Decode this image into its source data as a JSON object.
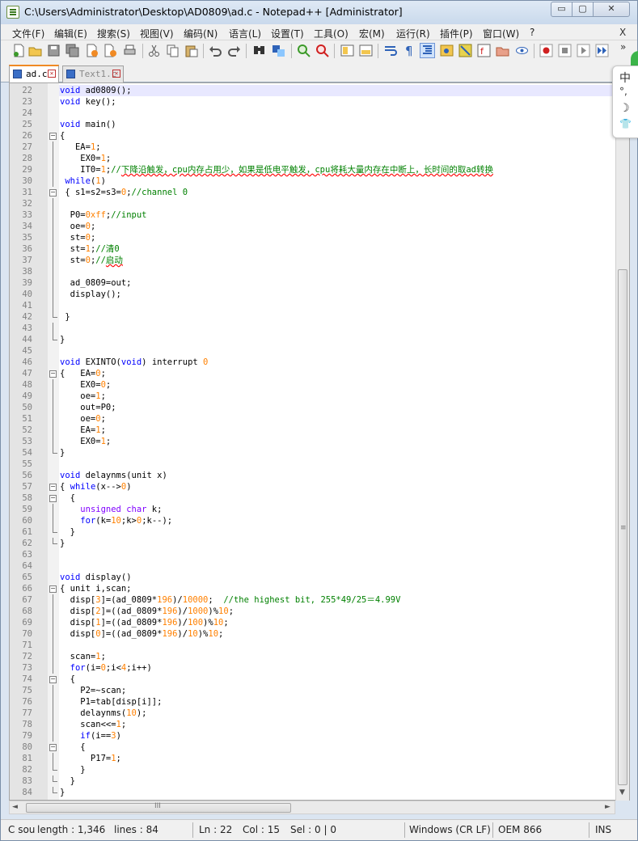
{
  "window": {
    "title": "C:\\Users\\Administrator\\Desktop\\AD0809\\ad.c - Notepad++ [Administrator]",
    "min_label": "▭",
    "max_label": "▢",
    "close_label": "✕"
  },
  "menu": {
    "items": [
      "文件(F)",
      "编辑(E)",
      "搜索(S)",
      "视图(V)",
      "编码(N)",
      "语言(L)",
      "设置(T)",
      "工具(O)",
      "宏(M)",
      "运行(R)",
      "插件(P)",
      "窗口(W)",
      "?"
    ],
    "close": "X"
  },
  "toolbar": {
    "overflow": "»",
    "icons": [
      "new-file-icon",
      "open-file-icon",
      "save-icon",
      "save-all-icon",
      "close-icon",
      "close-all-icon",
      "print-icon",
      "cut-icon",
      "copy-icon",
      "paste-icon",
      "undo-icon",
      "redo-icon",
      "find-icon",
      "replace-icon",
      "zoom-in-icon",
      "zoom-out-icon",
      "sync-vertical-icon",
      "sync-horizontal-icon",
      "word-wrap-icon",
      "show-all-chars-icon",
      "indent-guide-icon",
      "user-lang-icon",
      "doc-map-icon",
      "function-list-icon",
      "folder-workspace-icon",
      "monitoring-icon",
      "record-macro-icon",
      "stop-macro-icon",
      "play-macro-icon",
      "run-macro-multiple-icon"
    ],
    "colors": {
      "green": "#3c9a2a",
      "blue": "#2e62b8",
      "red": "#d02020",
      "orange": "#f08a24"
    }
  },
  "tabs": [
    {
      "label": "ad.c",
      "active": true
    },
    {
      "label": "Text1.c",
      "active": false
    }
  ],
  "ime": {
    "glyphs": [
      "中",
      "°,",
      "☽",
      "👕"
    ]
  },
  "editor": {
    "lines": [
      {
        "n": "22",
        "fold": "",
        "html": "<span class=\"kw\">void</span> ad0809();"
      },
      {
        "n": "23",
        "fold": "",
        "html": "<span class=\"kw\">void</span> key();"
      },
      {
        "n": "24",
        "fold": "",
        "html": ""
      },
      {
        "n": "25",
        "fold": "",
        "html": "<span class=\"kw\">void</span> main()"
      },
      {
        "n": "26",
        "fold": "box",
        "html": "{"
      },
      {
        "n": "27",
        "fold": "line",
        "html": "   EA=<span class=\"num\">1</span>;"
      },
      {
        "n": "28",
        "fold": "line",
        "html": "    EX0=<span class=\"num\">1</span>;"
      },
      {
        "n": "29",
        "fold": "line",
        "html": "    IT0=<span class=\"num\">1</span>;<span class=\"cmt\">//</span><span class=\"cmt-cn\">下降沿触发，cpu内存占用少，如果是低电平触发，cpu将耗大量内存在中断上，长时间的取ad转换</span>"
      },
      {
        "n": "30",
        "fold": "line",
        "html": " <span class=\"kw\">while</span>(<span class=\"num\">1</span>)"
      },
      {
        "n": "31",
        "fold": "box",
        "html": " { s1=s2=s3=<span class=\"num\">0</span>;<span class=\"cmt\">//channel 0</span>"
      },
      {
        "n": "32",
        "fold": "line",
        "html": "    "
      },
      {
        "n": "33",
        "fold": "line",
        "html": "  P0=<span class=\"num\">0xff</span>;<span class=\"cmt\">//input</span>"
      },
      {
        "n": "34",
        "fold": "line",
        "html": "  oe=<span class=\"num\">0</span>;"
      },
      {
        "n": "35",
        "fold": "line",
        "html": "  st=<span class=\"num\">0</span>;"
      },
      {
        "n": "36",
        "fold": "line",
        "html": "  st=<span class=\"num\">1</span>;<span class=\"cmt\">//清0</span>"
      },
      {
        "n": "37",
        "fold": "line",
        "html": "  st=<span class=\"num\">0</span>;<span class=\"cmt\">//</span><span class=\"cmt-cn\">启动</span>"
      },
      {
        "n": "38",
        "fold": "line",
        "html": ""
      },
      {
        "n": "39",
        "fold": "line",
        "html": "  ad_0809=out;"
      },
      {
        "n": "40",
        "fold": "line",
        "html": "  display();"
      },
      {
        "n": "41",
        "fold": "line",
        "html": ""
      },
      {
        "n": "42",
        "fold": "end",
        "html": " }"
      },
      {
        "n": "43",
        "fold": "line",
        "html": ""
      },
      {
        "n": "44",
        "fold": "end",
        "html": "}"
      },
      {
        "n": "45",
        "fold": "",
        "html": ""
      },
      {
        "n": "46",
        "fold": "",
        "html": "<span class=\"kw\">void</span> EXINTO(<span class=\"kw\">void</span>) interrupt <span class=\"num\">0</span>"
      },
      {
        "n": "47",
        "fold": "box",
        "html": "{   EA=<span class=\"num\">0</span>;"
      },
      {
        "n": "48",
        "fold": "line",
        "html": "    EX0=<span class=\"num\">0</span>;"
      },
      {
        "n": "49",
        "fold": "line",
        "html": "    oe=<span class=\"num\">1</span>;"
      },
      {
        "n": "50",
        "fold": "line",
        "html": "    out=P0;"
      },
      {
        "n": "51",
        "fold": "line",
        "html": "    oe=<span class=\"num\">0</span>;"
      },
      {
        "n": "52",
        "fold": "line",
        "html": "    EA=<span class=\"num\">1</span>;"
      },
      {
        "n": "53",
        "fold": "line",
        "html": "    EX0=<span class=\"num\">1</span>;"
      },
      {
        "n": "54",
        "fold": "end",
        "html": "}"
      },
      {
        "n": "55",
        "fold": "",
        "html": ""
      },
      {
        "n": "56",
        "fold": "",
        "html": "<span class=\"kw\">void</span> delaynms(unit x)"
      },
      {
        "n": "57",
        "fold": "box",
        "html": "{ <span class=\"kw\">while</span>(x--&gt;<span class=\"num\">0</span>)"
      },
      {
        "n": "58",
        "fold": "box",
        "html": "  {"
      },
      {
        "n": "59",
        "fold": "line",
        "html": "    <span class=\"typ\">unsigned char</span> k;"
      },
      {
        "n": "60",
        "fold": "line",
        "html": "    <span class=\"kw\">for</span>(k=<span class=\"num\">10</span>;k&gt;<span class=\"num\">0</span>;k--);"
      },
      {
        "n": "61",
        "fold": "end",
        "html": "  }"
      },
      {
        "n": "62",
        "fold": "end",
        "html": "}"
      },
      {
        "n": "63",
        "fold": "",
        "html": ""
      },
      {
        "n": "64",
        "fold": "",
        "html": ""
      },
      {
        "n": "65",
        "fold": "",
        "html": "<span class=\"kw\">void</span> display()"
      },
      {
        "n": "66",
        "fold": "box",
        "html": "{ unit i,scan;"
      },
      {
        "n": "67",
        "fold": "line",
        "html": "  disp[<span class=\"num\">3</span>]=(ad_0809*<span class=\"num\">196</span>)/<span class=\"num\">10000</span>;  <span class=\"cmt\">//the highest bit, 255*49/25＝4.99V</span>"
      },
      {
        "n": "68",
        "fold": "line",
        "html": "  disp[<span class=\"num\">2</span>]=((ad_0809*<span class=\"num\">196</span>)/<span class=\"num\">1000</span>)%<span class=\"num\">10</span>;"
      },
      {
        "n": "69",
        "fold": "line",
        "html": "  disp[<span class=\"num\">1</span>]=((ad_0809*<span class=\"num\">196</span>)/<span class=\"num\">100</span>)%<span class=\"num\">10</span>;"
      },
      {
        "n": "70",
        "fold": "line",
        "html": "  disp[<span class=\"num\">0</span>]=((ad_0809*<span class=\"num\">196</span>)/<span class=\"num\">10</span>)%<span class=\"num\">10</span>;"
      },
      {
        "n": "71",
        "fold": "line",
        "html": ""
      },
      {
        "n": "72",
        "fold": "line",
        "html": "  scan=<span class=\"num\">1</span>;"
      },
      {
        "n": "73",
        "fold": "line",
        "html": "  <span class=\"kw\">for</span>(i=<span class=\"num\">0</span>;i&lt;<span class=\"num\">4</span>;i++)"
      },
      {
        "n": "74",
        "fold": "box",
        "html": "  {"
      },
      {
        "n": "75",
        "fold": "line",
        "html": "    P2=~scan;"
      },
      {
        "n": "76",
        "fold": "line",
        "html": "    P1=tab[disp[i]];"
      },
      {
        "n": "77",
        "fold": "line",
        "html": "    delaynms(<span class=\"num\">10</span>);"
      },
      {
        "n": "78",
        "fold": "line",
        "html": "    scan&lt;&lt;=<span class=\"num\">1</span>;"
      },
      {
        "n": "79",
        "fold": "line",
        "html": "    <span class=\"kw\">if</span>(i==<span class=\"num\">3</span>)"
      },
      {
        "n": "80",
        "fold": "box",
        "html": "    {"
      },
      {
        "n": "81",
        "fold": "line",
        "html": "      P17=<span class=\"num\">1</span>;"
      },
      {
        "n": "82",
        "fold": "end",
        "html": "    }"
      },
      {
        "n": "83",
        "fold": "end",
        "html": "  }"
      },
      {
        "n": "84",
        "fold": "end",
        "html": "}"
      }
    ]
  },
  "scroll": {
    "vgrip": "≡",
    "hgrip": "III",
    "up": "▲",
    "down": "▼",
    "left": "◄",
    "right": "►"
  },
  "status": {
    "type": "C sou",
    "length": "length : 1,346",
    "lines": "lines : 84",
    "ln": "Ln : 22",
    "col": "Col : 15",
    "sel": "Sel : 0 | 0",
    "eol": "Windows (CR LF)",
    "encoding": "OEM 866",
    "mode": "INS"
  }
}
